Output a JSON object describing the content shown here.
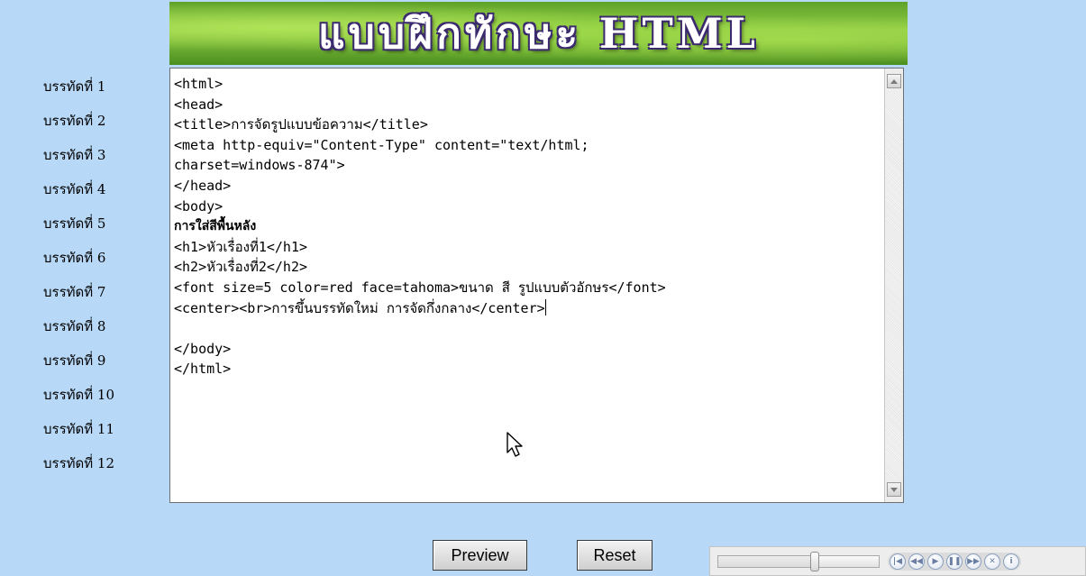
{
  "banner": {
    "title": "แบบฝึกทักษะ HTML"
  },
  "line_labels": [
    "บรรทัดที่ 1",
    "บรรทัดที่ 2",
    "บรรทัดที่ 3",
    "บรรทัดที่ 4",
    "บรรทัดที่ 5",
    "บรรทัดที่ 6",
    "บรรทัดที่ 7",
    "บรรทัดที่ 8",
    "บรรทัดที่ 9",
    "บรรทัดที่ 10",
    "บรรทัดที่ 11",
    "บรรทัดที่ 12"
  ],
  "editor": {
    "lines": [
      "<html>",
      "<head>",
      "<title>การจัดรูปแบบข้อความ</title>",
      "<meta http-equiv=\"Content-Type\" content=\"text/html;",
      "charset=windows-874\">",
      "</head>",
      "<body>",
      "การใส่สีพื้นหลัง",
      "<h1>หัวเรื่องที่1</h1>",
      "<h2>หัวเรื่องที่2</h2>",
      "<font size=5 color=red face=tahoma>ขนาด สี รูปแบบตัวอักษร</font>",
      "<center><br>การขึ้นบรรทัดใหม่ การจัดกึ่งกลาง</center>",
      "",
      "</body>",
      "</html>"
    ]
  },
  "buttons": {
    "preview": "Preview",
    "reset": "Reset"
  },
  "player": {
    "progress_fraction": 0.6,
    "controls": [
      "skip-back",
      "rewind",
      "play",
      "pause",
      "fast-forward",
      "stop",
      "info"
    ]
  },
  "icons": {
    "scroll_up": "scroll-up-arrow-icon",
    "scroll_down": "scroll-down-arrow-icon",
    "mouse_pointer": "mouse-pointer-icon"
  }
}
